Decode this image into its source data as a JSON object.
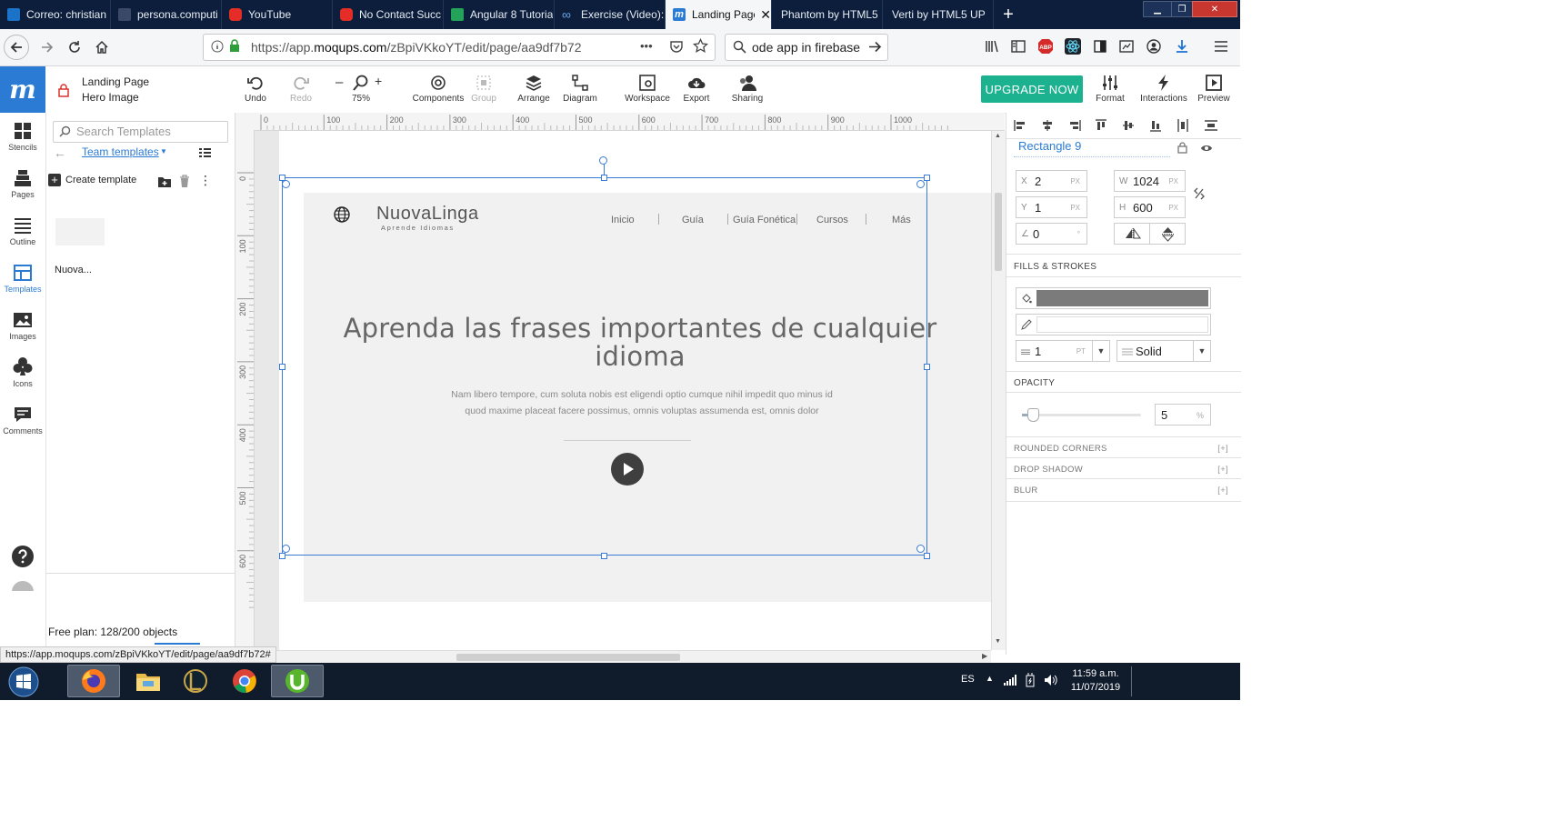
{
  "browser": {
    "tabs": [
      {
        "title": "Correo: christian",
        "icon": "outlook-icon",
        "color": "#1a73c8"
      },
      {
        "title": "persona.computi",
        "icon": "page-icon",
        "color": "#3a4a66"
      },
      {
        "title": "YouTube",
        "icon": "youtube-icon",
        "color": "#e52d27"
      },
      {
        "title": "No Contact Succ",
        "icon": "youtube-icon",
        "color": "#e52d27"
      },
      {
        "title": "Angular 8 Tutoria",
        "icon": "sheets-icon",
        "color": "#23a35a"
      },
      {
        "title": "Exercise (Video):",
        "icon": "infinity-icon",
        "color": "#6aa7e8"
      },
      {
        "title": "Landing Page",
        "icon": "moqups-icon",
        "color": "#2b7bd4",
        "active": true
      },
      {
        "title": "Phantom by HTML5",
        "icon": "none",
        "color": "#0c1e3b"
      },
      {
        "title": "Verti by HTML5 UP",
        "icon": "none",
        "color": "#0c1e3b"
      }
    ],
    "url_prefix": "https://app.",
    "url_domain": "moqups.com",
    "url_path": "/zBpiVKkoYT/edit/page/aa9df7b72",
    "url_more": "•••",
    "search_value": "ode app in firebase",
    "status_url": "https://app.moqups.com/zBpiVKkoYT/edit/page/aa9df7b72#",
    "abp_label": "ABP"
  },
  "app": {
    "logo_letter": "m",
    "doc_title": "Landing Page",
    "doc_page": "Hero Image",
    "toolbar": {
      "undo": "Undo",
      "redo": "Redo",
      "zoom_minus": "–",
      "zoom_plus": "+",
      "zoom": "75%",
      "components": "Components",
      "group": "Group",
      "arrange": "Arrange",
      "diagram": "Diagram",
      "workspace": "Workspace",
      "export": "Export",
      "sharing": "Sharing",
      "upgrade": "UPGRADE NOW",
      "format": "Format",
      "interactions": "Interactions",
      "preview": "Preview"
    },
    "rail": [
      "Stencils",
      "Pages",
      "Outline",
      "Templates",
      "Images",
      "Icons",
      "Comments"
    ],
    "left_panel": {
      "search_placeholder": "Search Templates",
      "section": "Team templates",
      "create": "Create template",
      "template_name": "Nuova...",
      "free_plan": "Free plan: 128/200 objects"
    },
    "ruler_h": [
      "0",
      "100",
      "200",
      "300",
      "400",
      "500",
      "600",
      "700",
      "800",
      "900",
      "1000"
    ],
    "ruler_v": [
      "0",
      "100",
      "200",
      "300",
      "400",
      "500",
      "600"
    ],
    "mockup": {
      "brand": "NuovaLinga",
      "tagline": "Aprende Idiomas",
      "nav": [
        "Inicio",
        "Guía",
        "Guía Fonética",
        "Cursos",
        "Más"
      ],
      "title": "Aprenda las frases importantes de cualquier idioma",
      "text": "Nam libero tempore, cum soluta nobis est eligendi optio cumque nihil impedit quo minus id quod maxime placeat facere possimus, omnis voluptas assumenda est, omnis dolor"
    },
    "inspector": {
      "name": "Rectangle 9",
      "x_label": "X",
      "x": "2",
      "y_label": "Y",
      "y": "1",
      "w_label": "W",
      "w": "1024",
      "h_label": "H",
      "h": "600",
      "angle": "0",
      "unit_px": "PX",
      "unit_deg": "°",
      "unit_pt": "PT",
      "unit_pct": "%",
      "fills_strokes": "FILLS & STROKES",
      "fill_color": "#7b7b7b",
      "stroke_width": "1",
      "stroke_style": "Solid",
      "opacity_label": "OPACITY",
      "opacity": "5",
      "rounded": "ROUNDED CORNERS",
      "shadow": "DROP SHADOW",
      "blur": "BLUR",
      "expand": "[+]"
    }
  },
  "taskbar": {
    "lang": "ES",
    "time": "11:59 a.m.",
    "date": "11/07/2019",
    "apps": [
      "windows-start-icon",
      "firefox-icon",
      "file-explorer-icon",
      "league-of-legends-icon",
      "chrome-icon",
      "utorrent-icon"
    ]
  },
  "colors": {
    "accent": "#2b7bd4",
    "upgrade": "#1db28f",
    "selection": "#3b7bd8",
    "tabbar": "#0c1e3b"
  }
}
